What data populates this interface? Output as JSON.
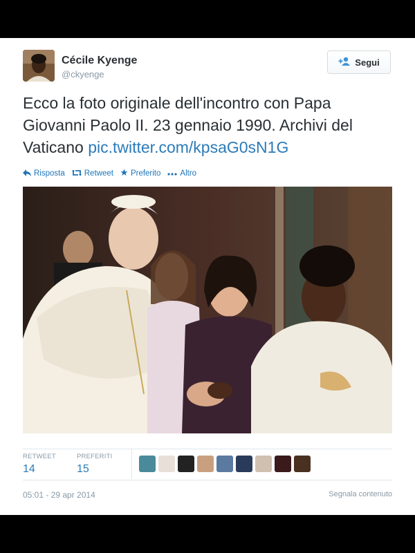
{
  "tweet": {
    "author_name": "Cécile Kyenge",
    "author_handle": "@ckyenge",
    "follow_label": "Segui",
    "text": "Ecco la foto originale dell'incontro con Papa Giovanni Paolo II. 23 gennaio 1990. Archivi del Vaticano ",
    "link": "pic.twitter.com/kpsaG0sN1G",
    "timestamp": "05:01 - 29 apr 2014",
    "report_label": "Segnala contenuto"
  },
  "actions": [
    {
      "label": "Risposta",
      "icon": "reply-icon"
    },
    {
      "label": "Retweet",
      "icon": "retweet-icon"
    },
    {
      "label": "Preferito",
      "icon": "star-icon"
    },
    {
      "label": "Altro",
      "icon": "more-icon"
    }
  ],
  "stats": {
    "retweets_label": "RETWEET",
    "retweets": "14",
    "favorites_label": "PREFERITI",
    "favorites": "15"
  },
  "colors": {
    "link": "#2b7bb9",
    "text": "#292f33",
    "muted": "#8899a6"
  }
}
